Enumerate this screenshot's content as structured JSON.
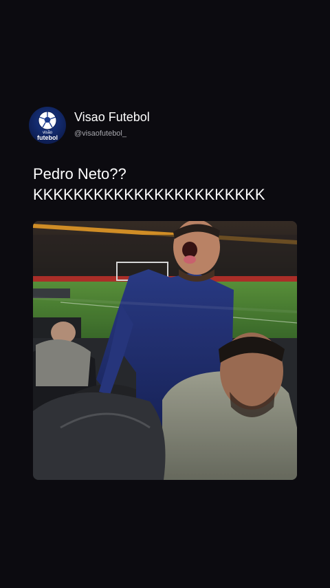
{
  "account": {
    "display_name": "Visao Futebol",
    "handle": "@visaofutebol_",
    "avatar_brand_small": "visão",
    "avatar_brand_main": "futebol"
  },
  "post": {
    "line1": "Pedro Neto??",
    "line2": "KKKKKKKKKKKKKKKKKKKKKKK"
  },
  "colors": {
    "background": "#0c0b10",
    "avatar_blue": "#1a3a8c",
    "text_primary": "#ffffff",
    "text_secondary": "#a7a7ad"
  },
  "icons": {
    "avatar": "soccer-ball-icon"
  }
}
